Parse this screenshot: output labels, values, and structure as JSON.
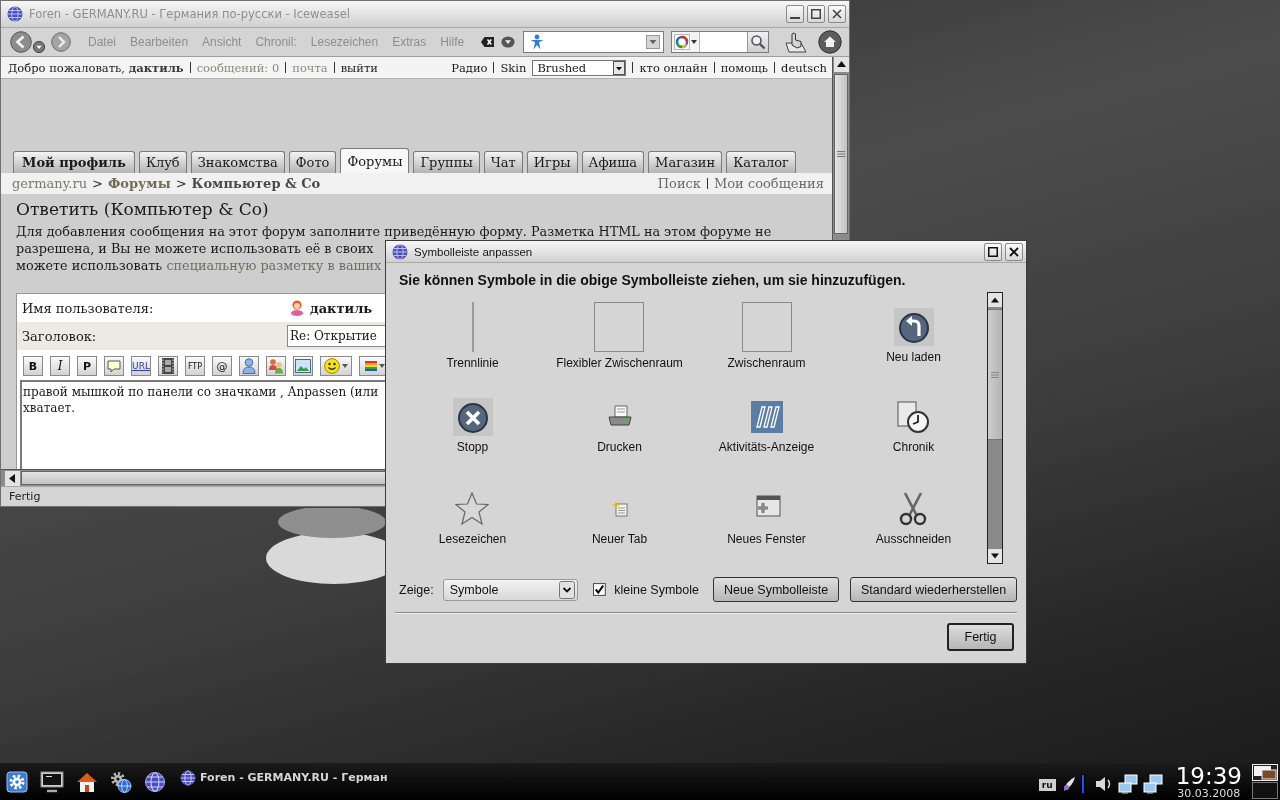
{
  "browser": {
    "title": "Foren - GERMANY.RU - Германия по-русски - Iceweasel",
    "focused": false,
    "menu": [
      {
        "label": "Datei",
        "disabled": true
      },
      {
        "label": "Bearbeiten",
        "disabled": true
      },
      {
        "label": "Ansicht",
        "disabled": true
      },
      {
        "label": "Chronil:",
        "disabled": true
      },
      {
        "label": "Lesezeichen",
        "disabled": true
      },
      {
        "label": "Extras",
        "disabled": true
      },
      {
        "label": "Hilfe",
        "disabled": true
      }
    ],
    "status": "Fertig"
  },
  "site_bar": {
    "greeting": "Добро пожаловать, **дактиль**",
    "links": [
      {
        "label": "сообщений: 0",
        "visited": true
      },
      {
        "label": "почта",
        "visited": true
      },
      {
        "label": "выйти",
        "visited": false
      }
    ],
    "radio": "Радио",
    "skin_label": "Skin",
    "skin_value": "Brushed",
    "right_links": [
      "кто онлайн",
      "помощь",
      "deutsch"
    ]
  },
  "tabs": [
    {
      "label": "Мой профиль",
      "kind": "profile",
      "selected": false
    },
    {
      "label": "Клуб",
      "kind": "section",
      "selected": false
    },
    {
      "label": "Знакомства",
      "kind": "section",
      "selected": false
    },
    {
      "label": "Фото",
      "kind": "section",
      "selected": false
    },
    {
      "label": "Форумы",
      "kind": "section",
      "selected": true
    },
    {
      "label": "Группы",
      "kind": "section",
      "selected": false
    },
    {
      "label": "Чат",
      "kind": "section",
      "selected": false
    },
    {
      "label": "Игры",
      "kind": "section",
      "selected": false
    },
    {
      "label": "Афиша",
      "kind": "section",
      "selected": false
    },
    {
      "label": "Магазин",
      "kind": "section",
      "selected": false
    },
    {
      "label": "Каталог",
      "kind": "section",
      "selected": false
    }
  ],
  "breadcrumb": {
    "separator": ">",
    "items": [
      {
        "label": "germany.ru",
        "kind": "home"
      },
      {
        "label": "Форумы",
        "kind": "section"
      },
      {
        "label": "Компьютер & Co",
        "kind": "current"
      }
    ],
    "links": [
      "Поиск",
      "Мои сообщения"
    ]
  },
  "reply": {
    "heading": "Ответить (Компьютер & Co)",
    "intro_lines": [
      "Для добавления сообщения на этот форум заполните приведённую форму. Разметка HTML на этом форуме не",
      "разрешена, и Вы не можете использовать её в своих",
      "можете использовать"
    ],
    "intro_link": "специальную разметку в ваших",
    "username_label": "Имя пользователя:",
    "username": "дактиль",
    "subject_label": "Заголовок:",
    "subject_value": "Re: Открытие",
    "editor_buttons": [
      {
        "kind": "text",
        "label": "B"
      },
      {
        "kind": "text",
        "label": "I"
      },
      {
        "kind": "text",
        "label": "P"
      },
      {
        "kind": "speech"
      },
      {
        "kind": "text",
        "label": "URL"
      },
      {
        "kind": "film"
      },
      {
        "kind": "text",
        "label": "FTP"
      },
      {
        "kind": "text",
        "label": "@"
      },
      {
        "kind": "person"
      },
      {
        "kind": "people"
      },
      {
        "kind": "picture"
      },
      {
        "kind": "smiley"
      },
      {
        "kind": "colors"
      }
    ],
    "message": "правой мышкой по панели со значками , Anpassen (или\nхватает."
  },
  "dialog": {
    "title": "Symbolleiste anpassen",
    "focused": true,
    "instruction": "Sie können Symbole in die obige Symbolleiste ziehen, um sie hinzuzufügen.",
    "items": [
      {
        "kind": "separator",
        "label": "Trennlinie"
      },
      {
        "kind": "flexspace",
        "label": "Flexibler Zwischenraum"
      },
      {
        "kind": "space",
        "label": "Zwischenraum"
      },
      {
        "kind": "reload",
        "label": "Neu laden"
      },
      {
        "kind": "stop",
        "label": "Stopp"
      },
      {
        "kind": "print",
        "label": "Drucken"
      },
      {
        "kind": "activity",
        "label": "Aktivitäts-Anzeige"
      },
      {
        "kind": "history",
        "label": "Chronik"
      },
      {
        "kind": "bookmark",
        "label": "Lesezeichen"
      },
      {
        "kind": "newtab",
        "label": "Neuer Tab"
      },
      {
        "kind": "newwindow",
        "label": "Neues Fenster"
      },
      {
        "kind": "cut",
        "label": "Ausschneiden"
      }
    ],
    "show_label": "Zeige:",
    "show_value": "Symbole",
    "small_icons": {
      "label": "kleine Symbole",
      "checked": true
    },
    "buttons": [
      {
        "label": "Neue Symbolleiste",
        "default": false
      },
      {
        "label": "Standard wiederherstellen",
        "default": false
      }
    ],
    "done": {
      "label": "Fertig",
      "default": true
    }
  },
  "taskbar": {
    "task": "Foren - GERMANY.RU - Герман",
    "keyboard": "ru",
    "time": "19:39",
    "date": "30.03.2008"
  }
}
